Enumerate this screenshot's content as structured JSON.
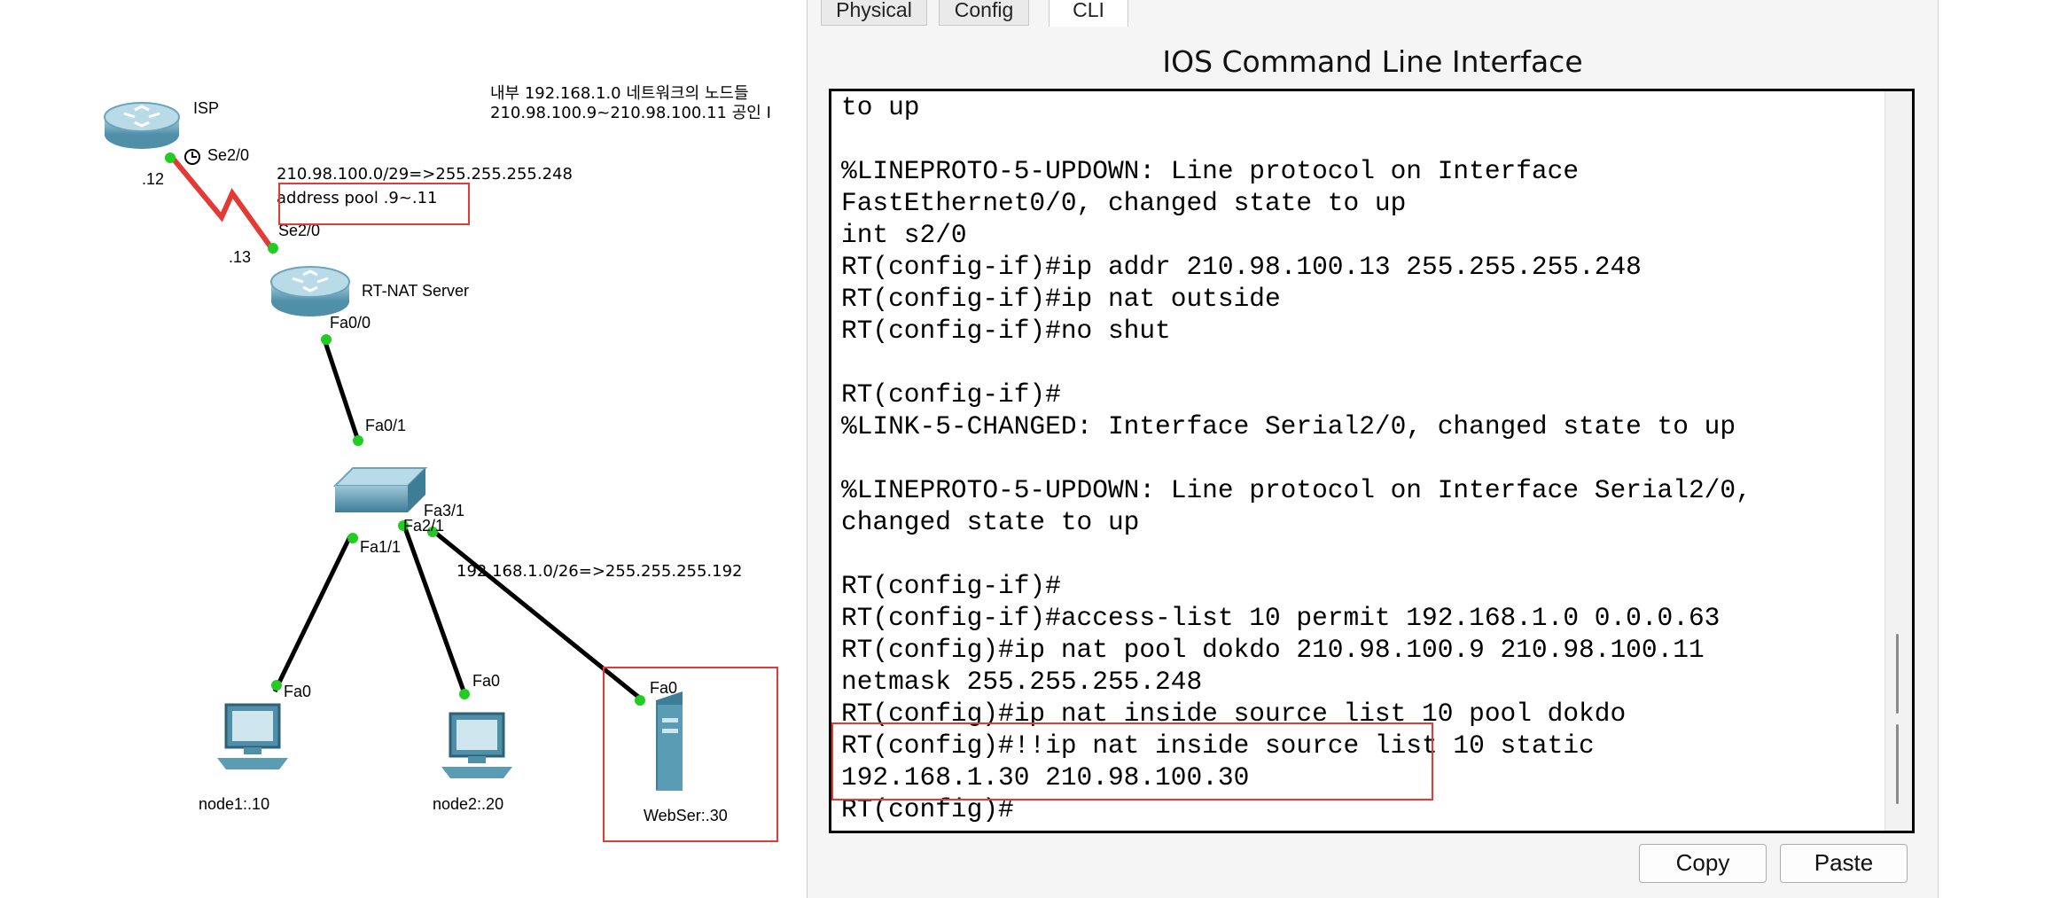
{
  "topology": {
    "devices": {
      "isp": "ISP",
      "rt_nat": "RT-NAT Server",
      "node1": "node1:.10",
      "node2": "node2:.20",
      "webser": "WebSer:.30"
    },
    "ports": {
      "isp_se": "Se2/0",
      "isp_ip": ".12",
      "rt_se": "Se2/0",
      "rt_ip": ".13",
      "rt_fa": "Fa0/0",
      "sw_fa01": "Fa0/1",
      "sw_fa31": "Fa3/1",
      "sw_fa21": "Fa2/1",
      "sw_fa11": "Fa1/1",
      "node1_fa": "Fa0",
      "node2_fa": "Fa0",
      "webser_fa": "Fa0"
    },
    "notes": {
      "wan_subnet": "210.98.100.0/29=>255.255.255.248",
      "address_pool": "address pool .9~.11",
      "lan_subnet": "192.168.1.0/26=>255.255.255.192",
      "korean_line1": "내부 192.168.1.0 네트워크의 노드들",
      "korean_line2": "210.98.100.9~210.98.100.11 공인 I"
    }
  },
  "window": {
    "tabs": [
      "Physical",
      "Config",
      "CLI"
    ],
    "active_tab": "CLI",
    "cli_title": "IOS Command Line Interface",
    "terminal_lines": [
      "to up",
      "",
      "%LINEPROTO-5-UPDOWN: Line protocol on Interface",
      "FastEthernet0/0, changed state to up",
      "int s2/0",
      "RT(config-if)#ip addr 210.98.100.13 255.255.255.248",
      "RT(config-if)#ip nat outside",
      "RT(config-if)#no shut",
      "",
      "RT(config-if)#",
      "%LINK-5-CHANGED: Interface Serial2/0, changed state to up",
      "",
      "%LINEPROTO-5-UPDOWN: Line protocol on Interface Serial2/0,",
      "changed state to up",
      "",
      "RT(config-if)#",
      "RT(config-if)#access-list 10 permit 192.168.1.0 0.0.0.63",
      "RT(config)#ip nat pool dokdo 210.98.100.9 210.98.100.11",
      "netmask 255.255.255.248",
      "RT(config)#ip nat inside source list 10 pool dokdo",
      "RT(config)#!!ip nat inside source list 10 static",
      "192.168.1.30 210.98.100.30",
      "RT(config)#"
    ],
    "buttons": {
      "copy": "Copy",
      "paste": "Paste"
    }
  },
  "colors": {
    "serial_link": "#e53935",
    "port_up": "#22cc22",
    "highlight_box": "#e53935",
    "device_blue": "#4f8fa8"
  }
}
